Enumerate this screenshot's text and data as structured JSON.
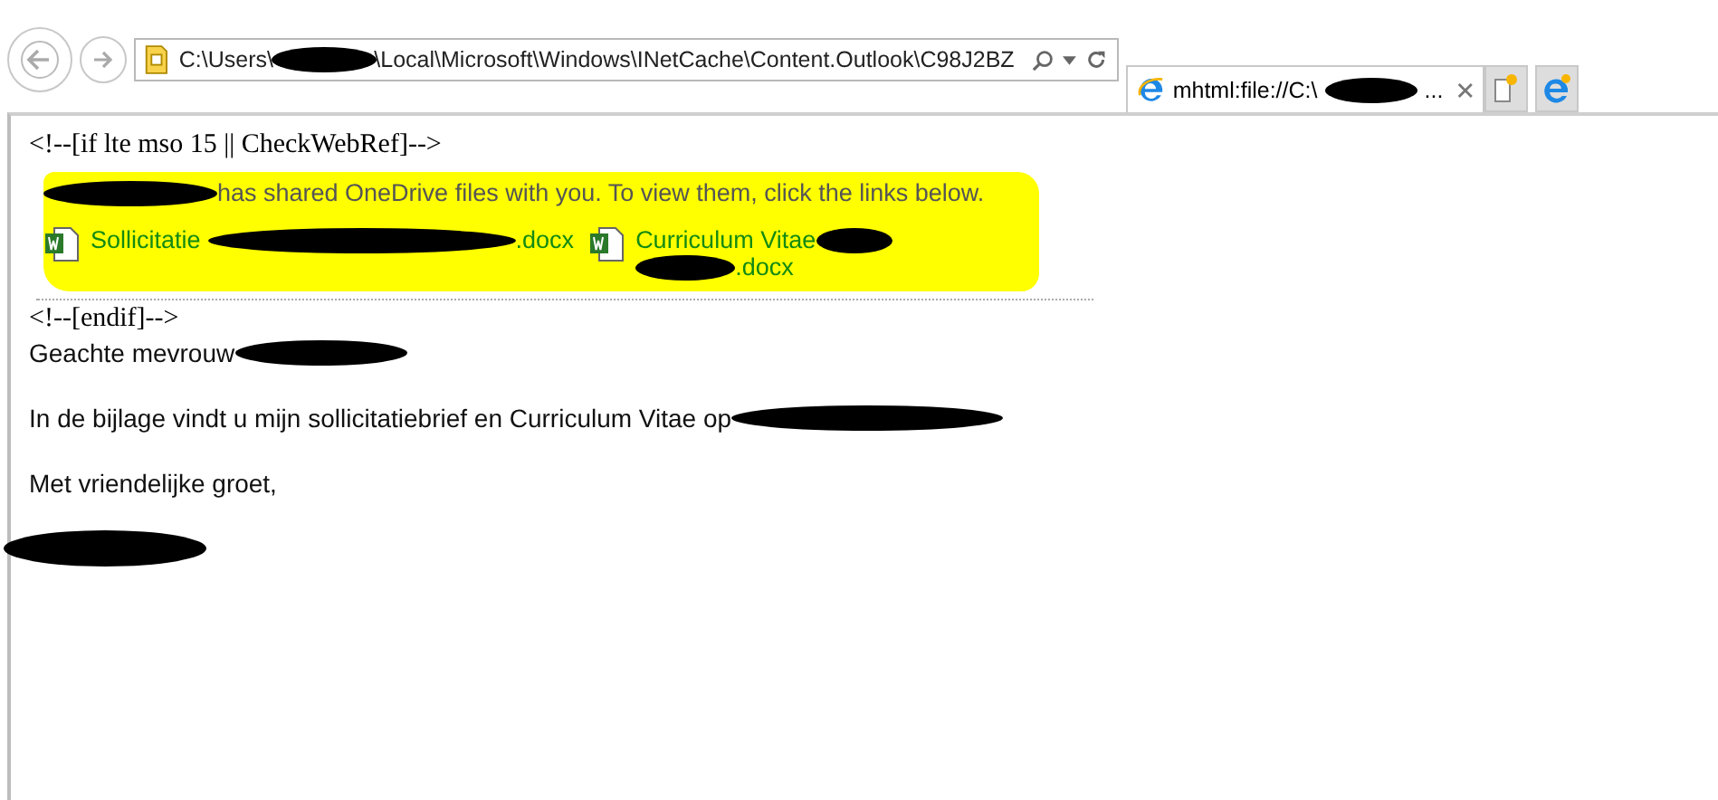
{
  "toolbar": {
    "address": {
      "before": "C:\\Users\\",
      "after": "\\Local\\Microsoft\\Windows\\INetCache\\Content.Outlook\\C98J2BZ"
    }
  },
  "tabs": [
    {
      "title_start": "mhtml:file://C:\\",
      "title_end": "...",
      "selected": true
    }
  ],
  "message": {
    "comment_open": "<!--[if lte mso 15 || CheckWebRef]-->",
    "share_notice": "has shared OneDrive files with you. To view them, click the links below.",
    "attachments": [
      {
        "name_start": "Sollicitatie",
        "name_end": ".docx"
      },
      {
        "name_start": "Curriculum Vitae",
        "name_end": ".docx"
      }
    ],
    "comment_close": "<!--[endif]-->",
    "greeting": "Geachte mevrouw",
    "body": "In de bijlage vindt u mijn sollicitatiebrief en Curriculum Vitae op",
    "closing": "Met vriendelijke groet,"
  }
}
